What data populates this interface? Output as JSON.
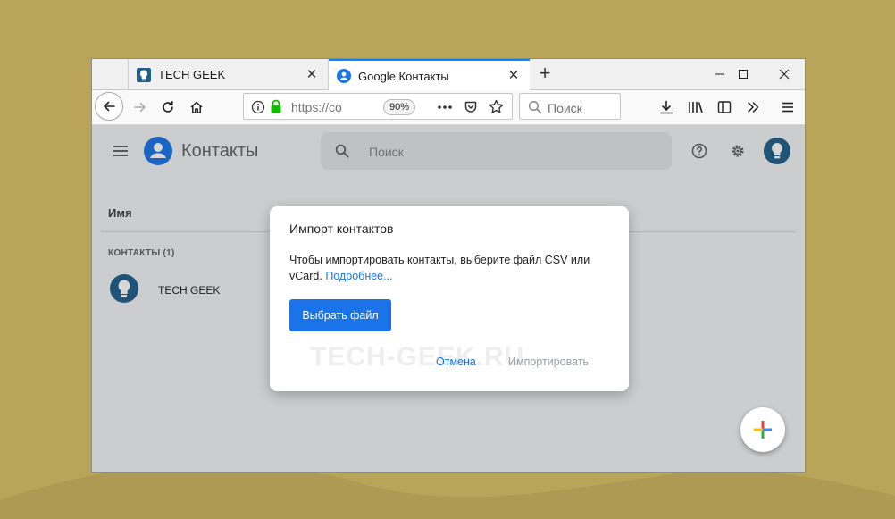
{
  "browser": {
    "tabs": [
      {
        "title": "TECH GEEK",
        "icon": "bulb-icon"
      },
      {
        "title": "Google Контакты",
        "icon": "contacts-icon"
      }
    ],
    "url": "https://co",
    "zoom": "90%",
    "search_placeholder": "Поиск"
  },
  "app": {
    "title": "Контакты",
    "search_placeholder": "Поиск",
    "column_header": "Имя",
    "contacts_header": "КОНТАКТЫ (1)",
    "contacts": [
      {
        "name": "TECH GEEK",
        "icon": "bulb-icon"
      }
    ]
  },
  "dialog": {
    "title": "Импорт контактов",
    "body": "Чтобы импортировать контакты, выберите файл CSV или vCard.",
    "link": "Подробнее...",
    "choose_button": "Выбрать файл",
    "cancel_button": "Отмена",
    "import_button": "Импортировать",
    "watermark": "TECH-GEEK.RU"
  },
  "colors": {
    "accent": "#1a73e8",
    "firefox_tab_accent": "#0a84ff",
    "background": "#b8a55a"
  }
}
